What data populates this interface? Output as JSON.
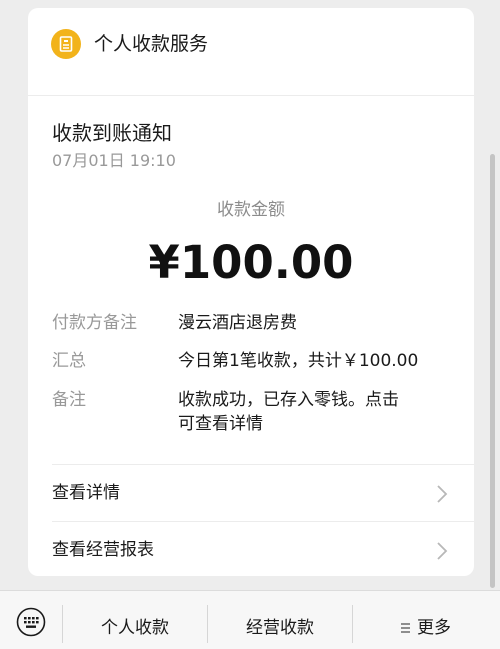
{
  "header": {
    "service_name": "个人收款服务",
    "icon": "wallet-icon",
    "accent": "#f2b31b"
  },
  "notice": {
    "title": "收款到账通知",
    "time": "07月01日 19:10"
  },
  "amount": {
    "label": "收款金额",
    "value": "¥100.00"
  },
  "details": [
    {
      "key": "付款方备注",
      "value": "漫云酒店退房费"
    },
    {
      "key": "汇总",
      "value": "今日第1笔收款，共计￥100.00"
    },
    {
      "key": "备注",
      "value": "收款成功，已存入零钱。点击\n可查看详情"
    }
  ],
  "links": [
    {
      "label": "查看详情",
      "icon": "chevron-right-icon"
    },
    {
      "label": "查看经营报表",
      "icon": "chevron-right-icon"
    }
  ],
  "bottom_bar": {
    "keyboard_icon": "keyboard-icon",
    "tabs": [
      "个人收款",
      "经营收款",
      "更多"
    ],
    "more_icon": "menu-lines-icon"
  }
}
